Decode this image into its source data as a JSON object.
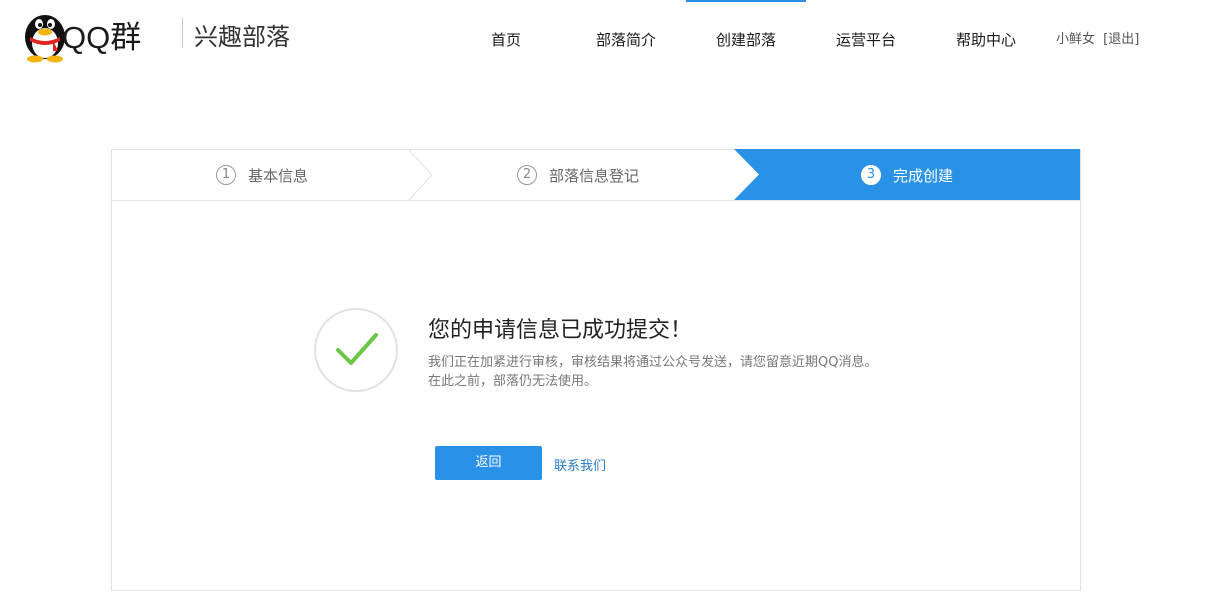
{
  "brand": {
    "logo_text": "QQ群",
    "subtitle": "兴趣部落"
  },
  "nav": {
    "items": [
      {
        "label": "首页",
        "active": false
      },
      {
        "label": "部落简介",
        "active": false
      },
      {
        "label": "创建部落",
        "active": true
      },
      {
        "label": "运营平台",
        "active": false
      },
      {
        "label": "帮助中心",
        "active": false
      }
    ]
  },
  "user": {
    "name": "小鲜女",
    "logout_label": "[退出]"
  },
  "steps": [
    {
      "num": "1",
      "label": "基本信息"
    },
    {
      "num": "2",
      "label": "部落信息登记"
    },
    {
      "num": "3",
      "label": "完成创建"
    }
  ],
  "result": {
    "title": "您的申请信息已成功提交！",
    "desc_line1": "我们正在加紧进行审核，审核结果将通过公众号发送，请您留意近期QQ消息。",
    "desc_line2": "在此之前，部落仍无法使用。"
  },
  "actions": {
    "back_label": "返回",
    "contact_label": "联系我们"
  },
  "colors": {
    "accent": "#2a92e6",
    "check": "#6cc644"
  }
}
